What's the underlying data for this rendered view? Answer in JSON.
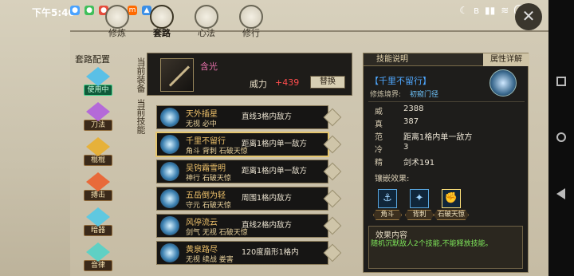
{
  "status_bar": {
    "time": "下午5:40",
    "battery": "83",
    "notification_icons": [
      "qq-icon",
      "wechat-icon",
      "weibo-icon",
      "gallery-icon",
      "mi-icon",
      "app-icon"
    ]
  },
  "top_tabs": [
    {
      "label": "修炼",
      "active": false
    },
    {
      "label": "套路",
      "active": true
    },
    {
      "label": "心法",
      "active": false
    },
    {
      "label": "修行",
      "active": false
    }
  ],
  "categories": {
    "title": "套路配置",
    "items": [
      {
        "label": "使用中",
        "active": true,
        "color": "#5ac0e6"
      },
      {
        "label": "刀法",
        "active": false,
        "color": "#b46ad8"
      },
      {
        "label": "棍棍",
        "active": false,
        "color": "#e6b13a"
      },
      {
        "label": "搏击",
        "active": false,
        "color": "#e86a3a"
      },
      {
        "label": "暗器",
        "active": false,
        "color": "#5fc8e0"
      },
      {
        "label": "音律",
        "active": false,
        "color": "#5fd0c4"
      }
    ]
  },
  "equipped": {
    "side_label": "当前装备",
    "name": "含光",
    "power_label": "威力",
    "power_value": "+439",
    "swap_button": "替换"
  },
  "skills": {
    "side_label": "当前技能",
    "items": [
      {
        "name": "天外插星",
        "tags": "无视  必中",
        "range": "直线3格内敌方",
        "selected": false
      },
      {
        "name": "千里不留行",
        "tags": "角斗  背刺  石破天惊",
        "range": "距离1格内单一敌方",
        "selected": true
      },
      {
        "name": "吴钩霜雪明",
        "tags": "神行  石破天惊",
        "range": "距离1格内单一敌方",
        "selected": false
      },
      {
        "name": "五岳倒为轻",
        "tags": "守元  石破天惊",
        "range": "周围1格内敌方",
        "selected": false
      },
      {
        "name": "风停流云",
        "tags": "剑气  无视  石破天惊",
        "range": "直线2格内敌方",
        "selected": false
      },
      {
        "name": "黄泉路尽",
        "tags": "无视  续战  娄害",
        "range": "120度扇形1格内",
        "selected": false
      }
    ]
  },
  "detail": {
    "tab_skill": "技能说明",
    "tab_attr": "属性详解",
    "skill_name": "【千里不留行】",
    "realm_label": "修炼境界:",
    "realm_value": "初窥门径",
    "stats": [
      {
        "label": "威",
        "value": "2388"
      },
      {
        "label": "真",
        "value": "387"
      },
      {
        "label": "范",
        "value": "距离1格内单一敌方"
      },
      {
        "label": "冷",
        "value": "3"
      },
      {
        "label": "精",
        "value": "剑术191"
      }
    ],
    "embed_label": "镶嵌效果:",
    "embeds": [
      {
        "label": "角斗",
        "icon": "anchor-icon",
        "selected": false
      },
      {
        "label": "背刺",
        "icon": "runner-icon",
        "selected": false
      },
      {
        "label": "石破天惊",
        "icon": "fist-icon",
        "selected": true
      }
    ],
    "effect_title": "效果内容",
    "effect_text": "随机沉默敌人2个技能,不能释放技能。"
  }
}
